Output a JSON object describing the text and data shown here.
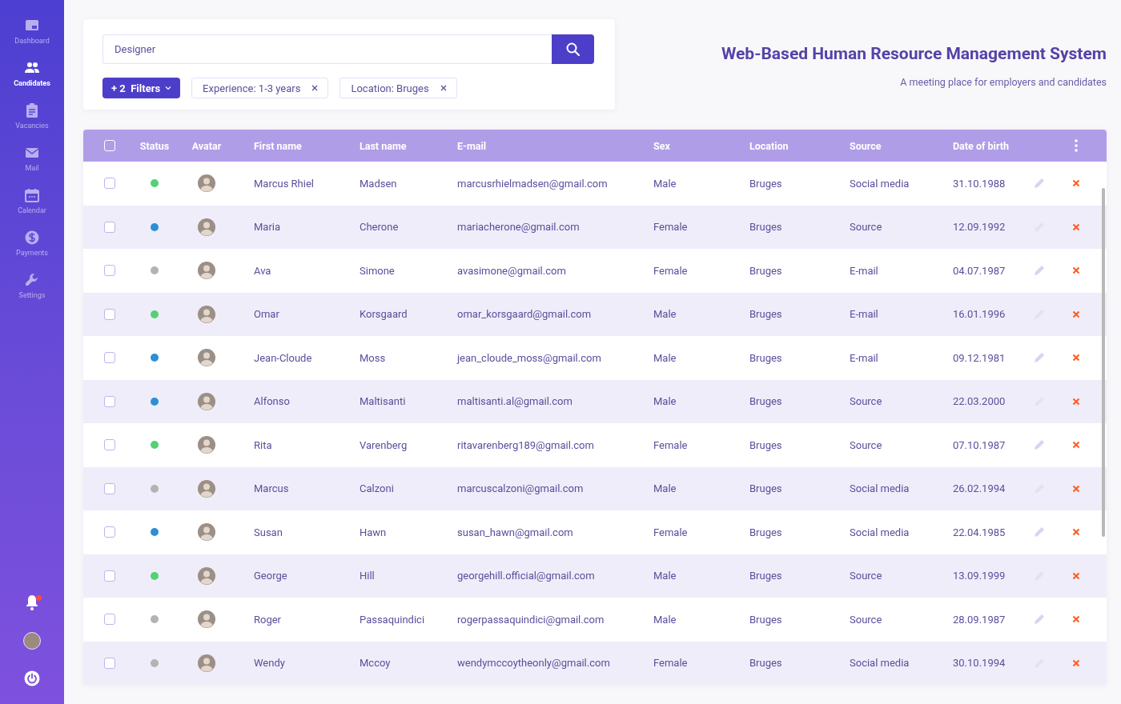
{
  "sidebar": {
    "items": [
      {
        "kind": "dashboard",
        "label": "Dashboard",
        "selected": false
      },
      {
        "kind": "people",
        "label": "Candidates",
        "selected": true
      },
      {
        "kind": "clipboard",
        "label": "Vacancies",
        "selected": false
      },
      {
        "kind": "mail",
        "label": "Mail",
        "selected": false
      },
      {
        "kind": "calendar",
        "label": "Calendar",
        "selected": false
      },
      {
        "kind": "dollar",
        "label": "Payments",
        "selected": false
      },
      {
        "kind": "wrench",
        "label": "Settings",
        "selected": false
      }
    ],
    "notifications": {
      "unread": true
    }
  },
  "search": {
    "value": "Designer"
  },
  "filters": {
    "button": "+ 2  Filters",
    "chips": [
      "Experience: 1-3 years",
      "Location: Bruges"
    ]
  },
  "header": {
    "title": "Web-Based Human Resource Management System",
    "subtitle": "A meeting place for employers and candidates"
  },
  "table": {
    "all_checked": false,
    "columns": [
      "Status",
      "Avatar",
      "First name",
      "Last name",
      "E-mail",
      "Sex",
      "Location",
      "Source",
      "Date of birth"
    ],
    "rows": [
      {
        "checked": false,
        "color": "#52d273",
        "first": "Marcus Rhiel",
        "last": "Madsen",
        "email": "marcusrhielmadsen@gmail.com",
        "sex": "Male",
        "location": "Bruges",
        "source": "Social media",
        "dob": "31.10.1988"
      },
      {
        "checked": false,
        "color": "#2d8fd5",
        "first": "Maria",
        "last": "Cherone",
        "email": "mariacherone@gmail.com",
        "sex": "Female",
        "location": "Bruges",
        "source": "Source",
        "dob": "12.09.1992"
      },
      {
        "checked": false,
        "color": "#b3b3b3",
        "first": "Ava",
        "last": "Simone",
        "email": "avasimone@gmail.com",
        "sex": "Female",
        "location": "Bruges",
        "source": "E-mail",
        "dob": "04.07.1987"
      },
      {
        "checked": false,
        "color": "#52d273",
        "first": "Omar",
        "last": "Korsgaard",
        "email": "omar_korsgaard@gmail.com",
        "sex": "Male",
        "location": "Bruges",
        "source": "E-mail",
        "dob": "16.01.1996"
      },
      {
        "checked": false,
        "color": "#2d8fd5",
        "first": "Jean-Cloude",
        "last": "Moss",
        "email": "jean_cloude_moss@gmail.com",
        "sex": "Male",
        "location": "Bruges",
        "source": "E-mail",
        "dob": "09.12.1981"
      },
      {
        "checked": false,
        "color": "#2d8fd5",
        "first": "Alfonso",
        "last": "Maltisanti",
        "email": "maltisanti.al@gmail.com",
        "sex": "Male",
        "location": "Bruges",
        "source": "Source",
        "dob": "22.03.2000"
      },
      {
        "checked": false,
        "color": "#52d273",
        "first": "Rita",
        "last": "Varenberg",
        "email": "ritavarenberg189@gmail.com",
        "sex": "Female",
        "location": "Bruges",
        "source": "Source",
        "dob": "07.10.1987"
      },
      {
        "checked": false,
        "color": "#b3b3b3",
        "first": "Marcus",
        "last": "Calzoni",
        "email": "marcuscalzoni@gmail.com",
        "sex": "Male",
        "location": "Bruges",
        "source": "Social media",
        "dob": "26.02.1994"
      },
      {
        "checked": false,
        "color": "#2d8fd5",
        "first": "Susan",
        "last": "Hawn",
        "email": "susan_hawn@gmail.com",
        "sex": "Female",
        "location": "Bruges",
        "source": "Social media",
        "dob": "22.04.1985"
      },
      {
        "checked": false,
        "color": "#52d273",
        "first": "George",
        "last": "Hill",
        "email": "georgehill.official@gmail.com",
        "sex": "Male",
        "location": "Bruges",
        "source": "Source",
        "dob": "13.09.1999"
      },
      {
        "checked": false,
        "color": "#b3b3b3",
        "first": "Roger",
        "last": "Passaquindici",
        "email": "rogerpassaquindici@gmail.com",
        "sex": "Male",
        "location": "Bruges",
        "source": "Source",
        "dob": "28.09.1987"
      },
      {
        "checked": false,
        "color": "#b3b3b3",
        "first": "Wendy",
        "last": "Mccoy",
        "email": "wendymccoytheonly@gmail.com",
        "sex": "Female",
        "location": "Bruges",
        "source": "Social media",
        "dob": "30.10.1994"
      }
    ]
  }
}
